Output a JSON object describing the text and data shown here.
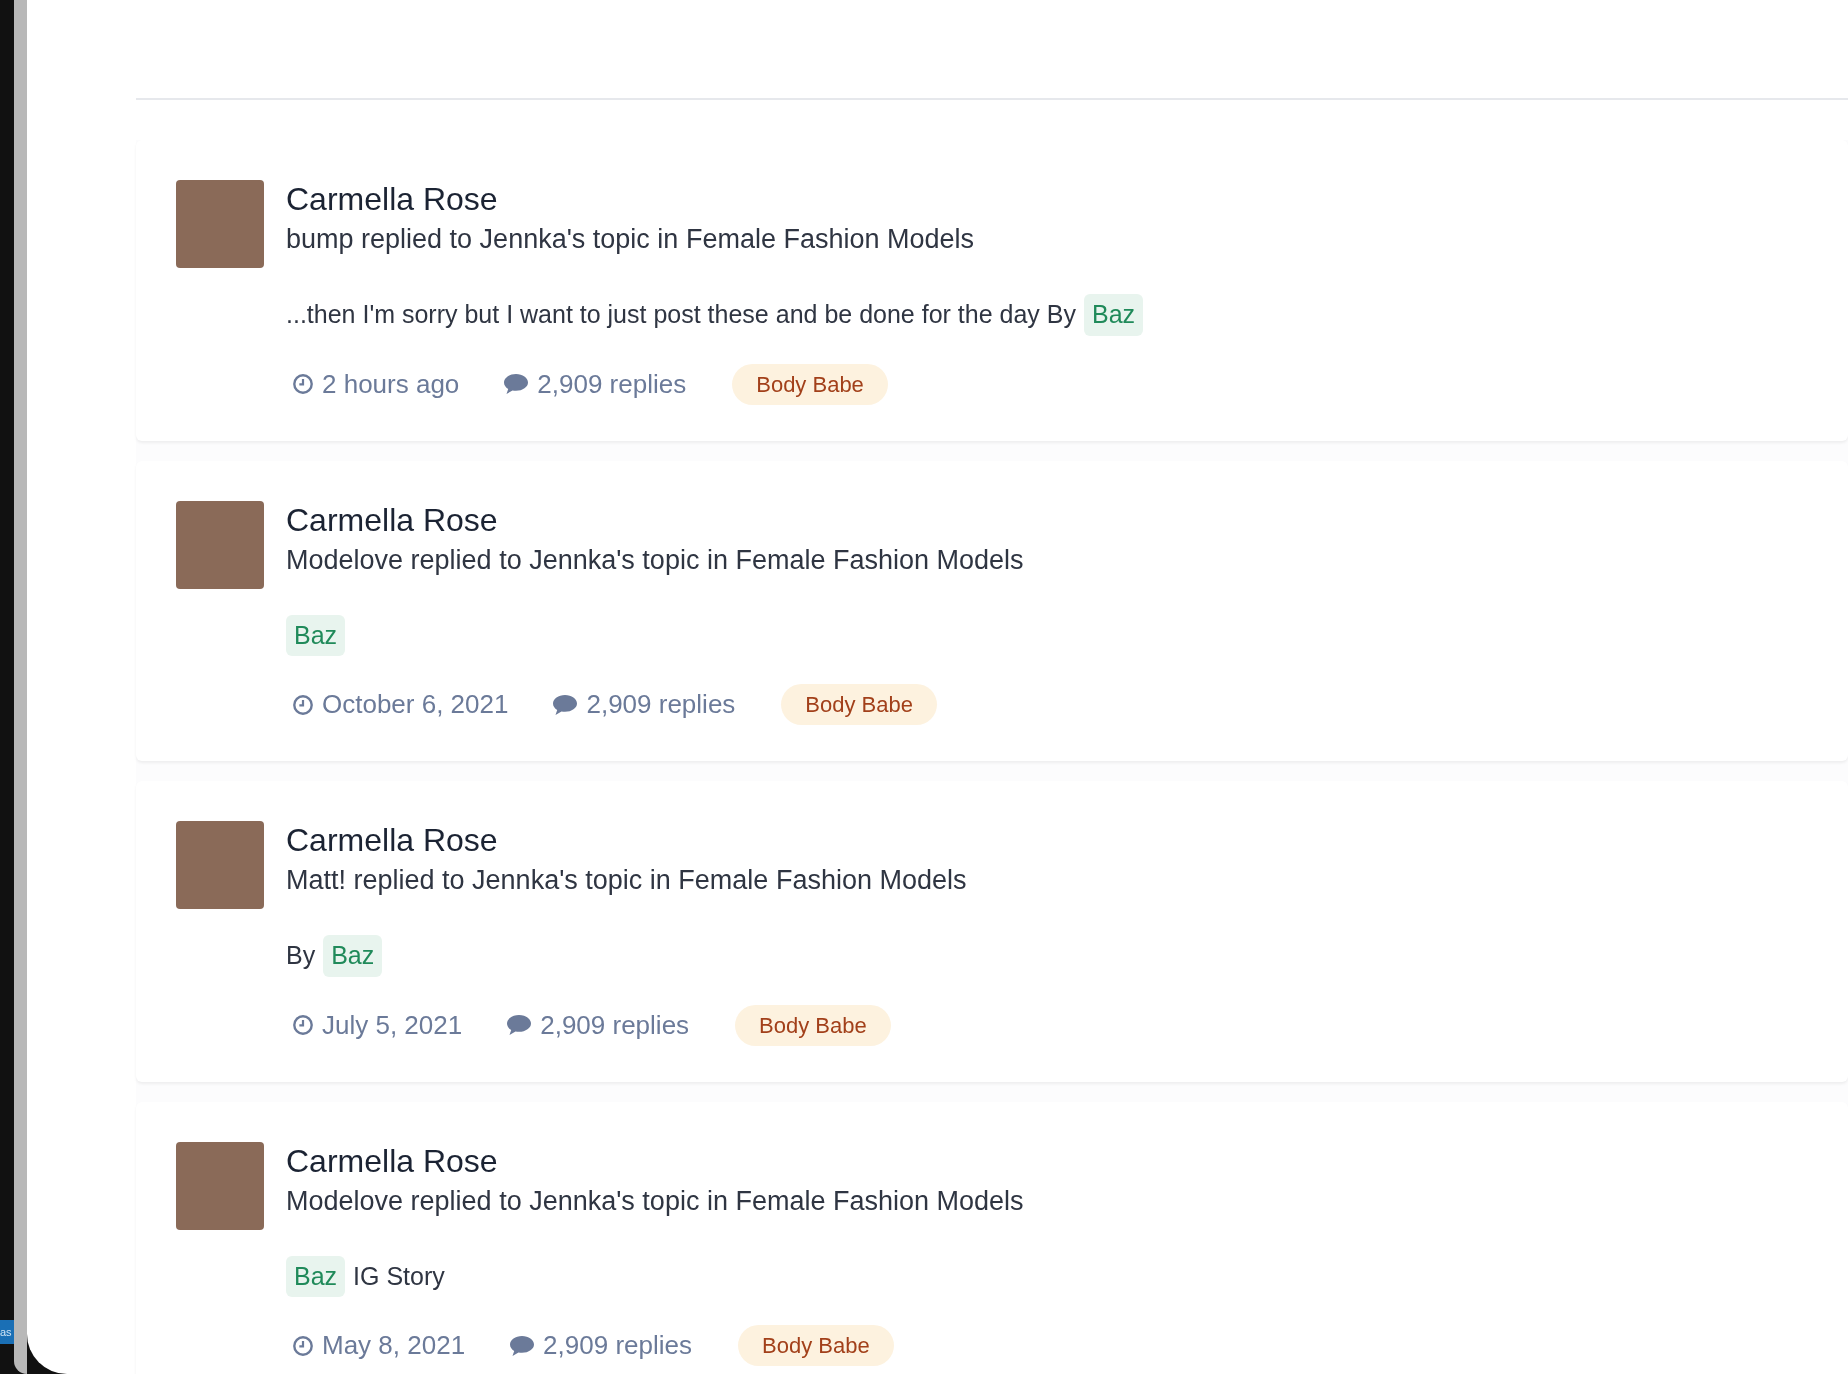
{
  "desktop": {
    "taskbar_fragment": "as"
  },
  "activities": [
    {
      "title": "Carmella Rose",
      "summary": "bump replied to Jennka's topic in Female Fashion Models",
      "snippet": [
        {
          "kind": "text",
          "text": "...then I'm sorry but I want to just post these and be done for the day By"
        },
        {
          "kind": "mention",
          "text": "Baz"
        }
      ],
      "time": "2 hours ago",
      "replies": "2,909 replies",
      "tag": "Body Babe"
    },
    {
      "title": "Carmella Rose",
      "summary": "Modelove replied to Jennka's topic in Female Fashion Models",
      "snippet": [
        {
          "kind": "mention",
          "text": "Baz"
        }
      ],
      "time": "October 6, 2021",
      "replies": "2,909 replies",
      "tag": "Body Babe"
    },
    {
      "title": "Carmella Rose",
      "summary": "Matt! replied to Jennka's topic in Female Fashion Models",
      "snippet": [
        {
          "kind": "text",
          "text": "By"
        },
        {
          "kind": "mention",
          "text": "Baz"
        }
      ],
      "time": "July 5, 2021",
      "replies": "2,909 replies",
      "tag": "Body Babe"
    },
    {
      "title": "Carmella Rose",
      "summary": "Modelove replied to Jennka's topic in Female Fashion Models",
      "snippet": [
        {
          "kind": "mention",
          "text": "Baz"
        },
        {
          "kind": "text",
          "text": "IG Story"
        }
      ],
      "time": "May 8, 2021",
      "replies": "2,909 replies",
      "tag": "Body Babe"
    }
  ]
}
